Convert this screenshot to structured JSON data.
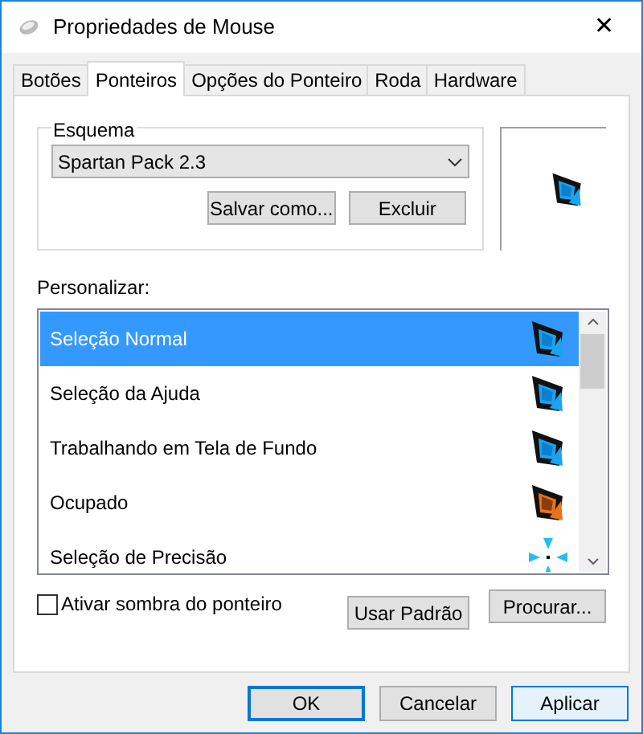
{
  "window": {
    "title": "Propriedades de Mouse",
    "close": "✕"
  },
  "tabs": [
    {
      "label": "Botões",
      "selected": false
    },
    {
      "label": "Ponteiros",
      "selected": true
    },
    {
      "label": "Opções do Ponteiro",
      "selected": false
    },
    {
      "label": "Roda",
      "selected": false
    },
    {
      "label": "Hardware",
      "selected": false
    }
  ],
  "scheme": {
    "label": "Esquema",
    "value": "Spartan Pack 2.3",
    "buttons": [
      "Salvar como...",
      "Excluir"
    ]
  },
  "customize": {
    "label": "Personalizar:",
    "items": [
      {
        "label": "Seleção Normal",
        "kind": "arrow",
        "selected": true
      },
      {
        "label": "Seleção da Ajuda",
        "kind": "arrow",
        "selected": false
      },
      {
        "label": "Trabalhando em Tela de Fundo",
        "kind": "arrow",
        "selected": false
      },
      {
        "label": "Ocupado",
        "kind": "busy",
        "selected": false
      },
      {
        "label": "Seleção de Precisão",
        "kind": "crosshair",
        "selected": false
      }
    ]
  },
  "shadow": {
    "label": "Ativar sombra do ponteiro",
    "checked": false
  },
  "list_buttons": [
    "Usar Padrão",
    "Procurar..."
  ],
  "dialog_buttons": [
    {
      "label": "OK",
      "default": true
    },
    {
      "label": "Cancelar",
      "default": false
    },
    {
      "label": "Aplicar",
      "default": false
    }
  ]
}
